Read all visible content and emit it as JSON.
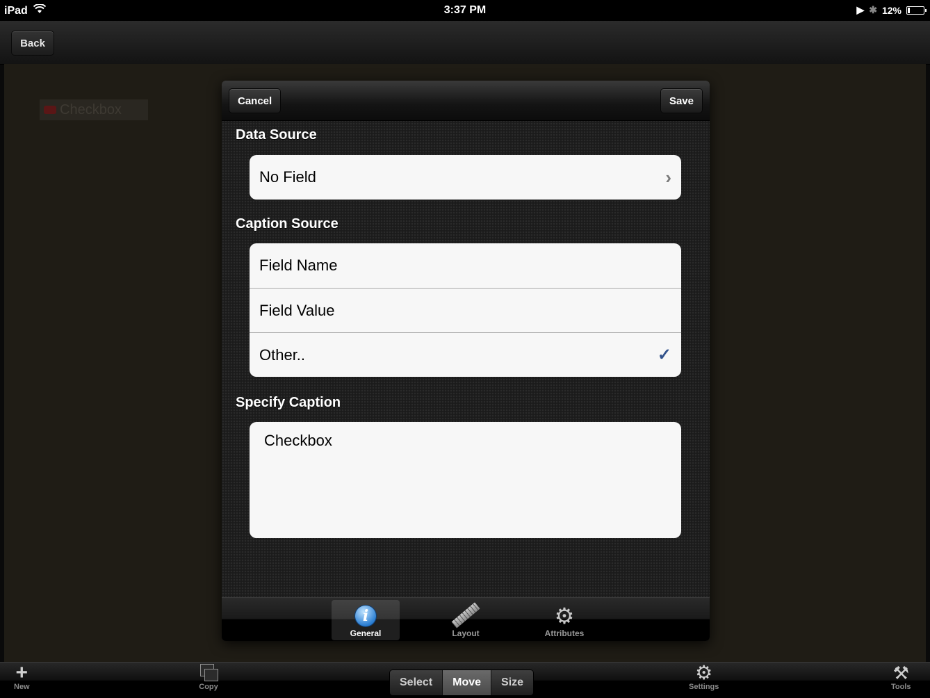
{
  "status_bar": {
    "device": "iPad",
    "time": "3:37 PM",
    "battery": "12%",
    "battery_level": 0.12
  },
  "nav": {
    "back_label": "Back"
  },
  "canvas": {
    "element_label": "Checkbox"
  },
  "popover": {
    "cancel_label": "Cancel",
    "save_label": "Save",
    "data_source": {
      "title": "Data Source",
      "value": "No Field"
    },
    "caption_source": {
      "title": "Caption Source",
      "options": [
        "Field Name",
        "Field Value",
        "Other.."
      ],
      "selected": "Other.."
    },
    "specify_caption": {
      "title": "Specify Caption",
      "text": "Checkbox"
    },
    "tabs": [
      {
        "label": "General",
        "icon": "info-icon",
        "active": true
      },
      {
        "label": "Layout",
        "icon": "ruler-icon",
        "active": false
      },
      {
        "label": "Attributes",
        "icon": "gear-icon",
        "active": false
      }
    ]
  },
  "toolbar": {
    "new_label": "New",
    "copy_label": "Copy",
    "segments": [
      "Select",
      "Move",
      "Size"
    ],
    "active_segment": "Move",
    "settings_label": "Settings",
    "tools_label": "Tools"
  },
  "colors": {
    "checkmark": "#33538c",
    "canvas_bg": "#1f1c15"
  }
}
